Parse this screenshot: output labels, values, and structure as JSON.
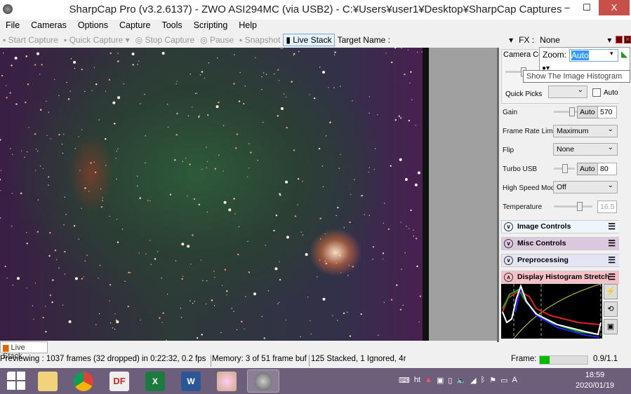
{
  "window": {
    "title": "SharpCap Pro (v3.2.6137) - ZWO ASI294MC (via USB2) - C:¥Users¥user1¥Desktop¥SharpCap Captures",
    "min": "–",
    "max": "☐",
    "close": "X"
  },
  "menu": [
    "File",
    "Cameras",
    "Options",
    "Capture",
    "Tools",
    "Scripting",
    "Help"
  ],
  "toolbar": {
    "start_capture": "Start Capture",
    "quick_capture": "Quick Capture",
    "stop_capture": "Stop Capture",
    "pause": "Pause",
    "snapshot": "Snapshot",
    "live_stack": "Live Stack",
    "target_label": "Target Name :",
    "target_value": "",
    "fx_label": "FX :",
    "fx_value": "None"
  },
  "zoom": {
    "label": "Zoom:",
    "value": "Auto",
    "tooltip": "Show The Image Histogram"
  },
  "camera_controls": {
    "header": "Camera Con",
    "quick_picks_label": "Quick Picks",
    "quick_picks_value": "",
    "auto_label": "Auto",
    "gain": {
      "label": "Gain",
      "auto": "Auto",
      "value": "570"
    },
    "frame_rate": {
      "label": "Frame Rate Limit",
      "value": "Maximum"
    },
    "flip": {
      "label": "Flip",
      "value": "None"
    },
    "turbo_usb": {
      "label": "Turbo USB",
      "auto": "Auto",
      "value": "80"
    },
    "high_speed": {
      "label": "High Speed Mode",
      "value": "Off"
    },
    "temperature": {
      "label": "Temperature",
      "value": "16.5"
    }
  },
  "sections": [
    {
      "label": "Image Controls",
      "color": "#eef6fc"
    },
    {
      "label": "Misc Controls",
      "color": "#dcc8de"
    },
    {
      "label": "Preprocessing",
      "color": "#e4e4f4"
    },
    {
      "label": "Display Histogram Stretch",
      "color": "#f7c0c8"
    }
  ],
  "live_stack_tab": "Live Stack",
  "status": {
    "preview": "Previewing : 1037 frames (32 dropped) in 0:22:32, 0.2 fps",
    "memory": "Memory: 3 of 51 frame buf",
    "stack": "125 Stacked, 1 Ignored, 4r",
    "frame_label": "Frame:",
    "frame_progress": 0.2,
    "frame_value": "0.9/1.1"
  },
  "taskbar": {
    "time": "18:59",
    "date": "2020/01/19",
    "tray_ime": "A"
  }
}
